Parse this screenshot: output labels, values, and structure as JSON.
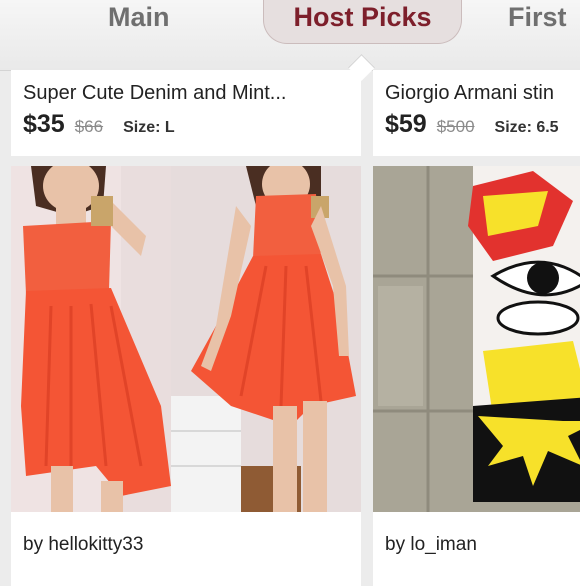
{
  "tabs": [
    {
      "label": "Main"
    },
    {
      "label": "Host Picks"
    },
    {
      "label": "First"
    }
  ],
  "listings": [
    {
      "title": "Super Cute Denim and Mint...",
      "price": "$35",
      "original_price": "$66",
      "size": "Size: L",
      "seller": "by hellokitty33",
      "image": "orange-chiffon-dress-photo"
    },
    {
      "title": "Giorgio Armani stin",
      "price": "$59",
      "original_price": "$500",
      "size": "Size: 6.5",
      "seller": "by lo_iman",
      "image": "pop-art-comic-print-skirt"
    }
  ],
  "colors": {
    "active_tab": "#7d1f2b",
    "tab_text": "#6f6f6f",
    "background": "#ececec"
  }
}
